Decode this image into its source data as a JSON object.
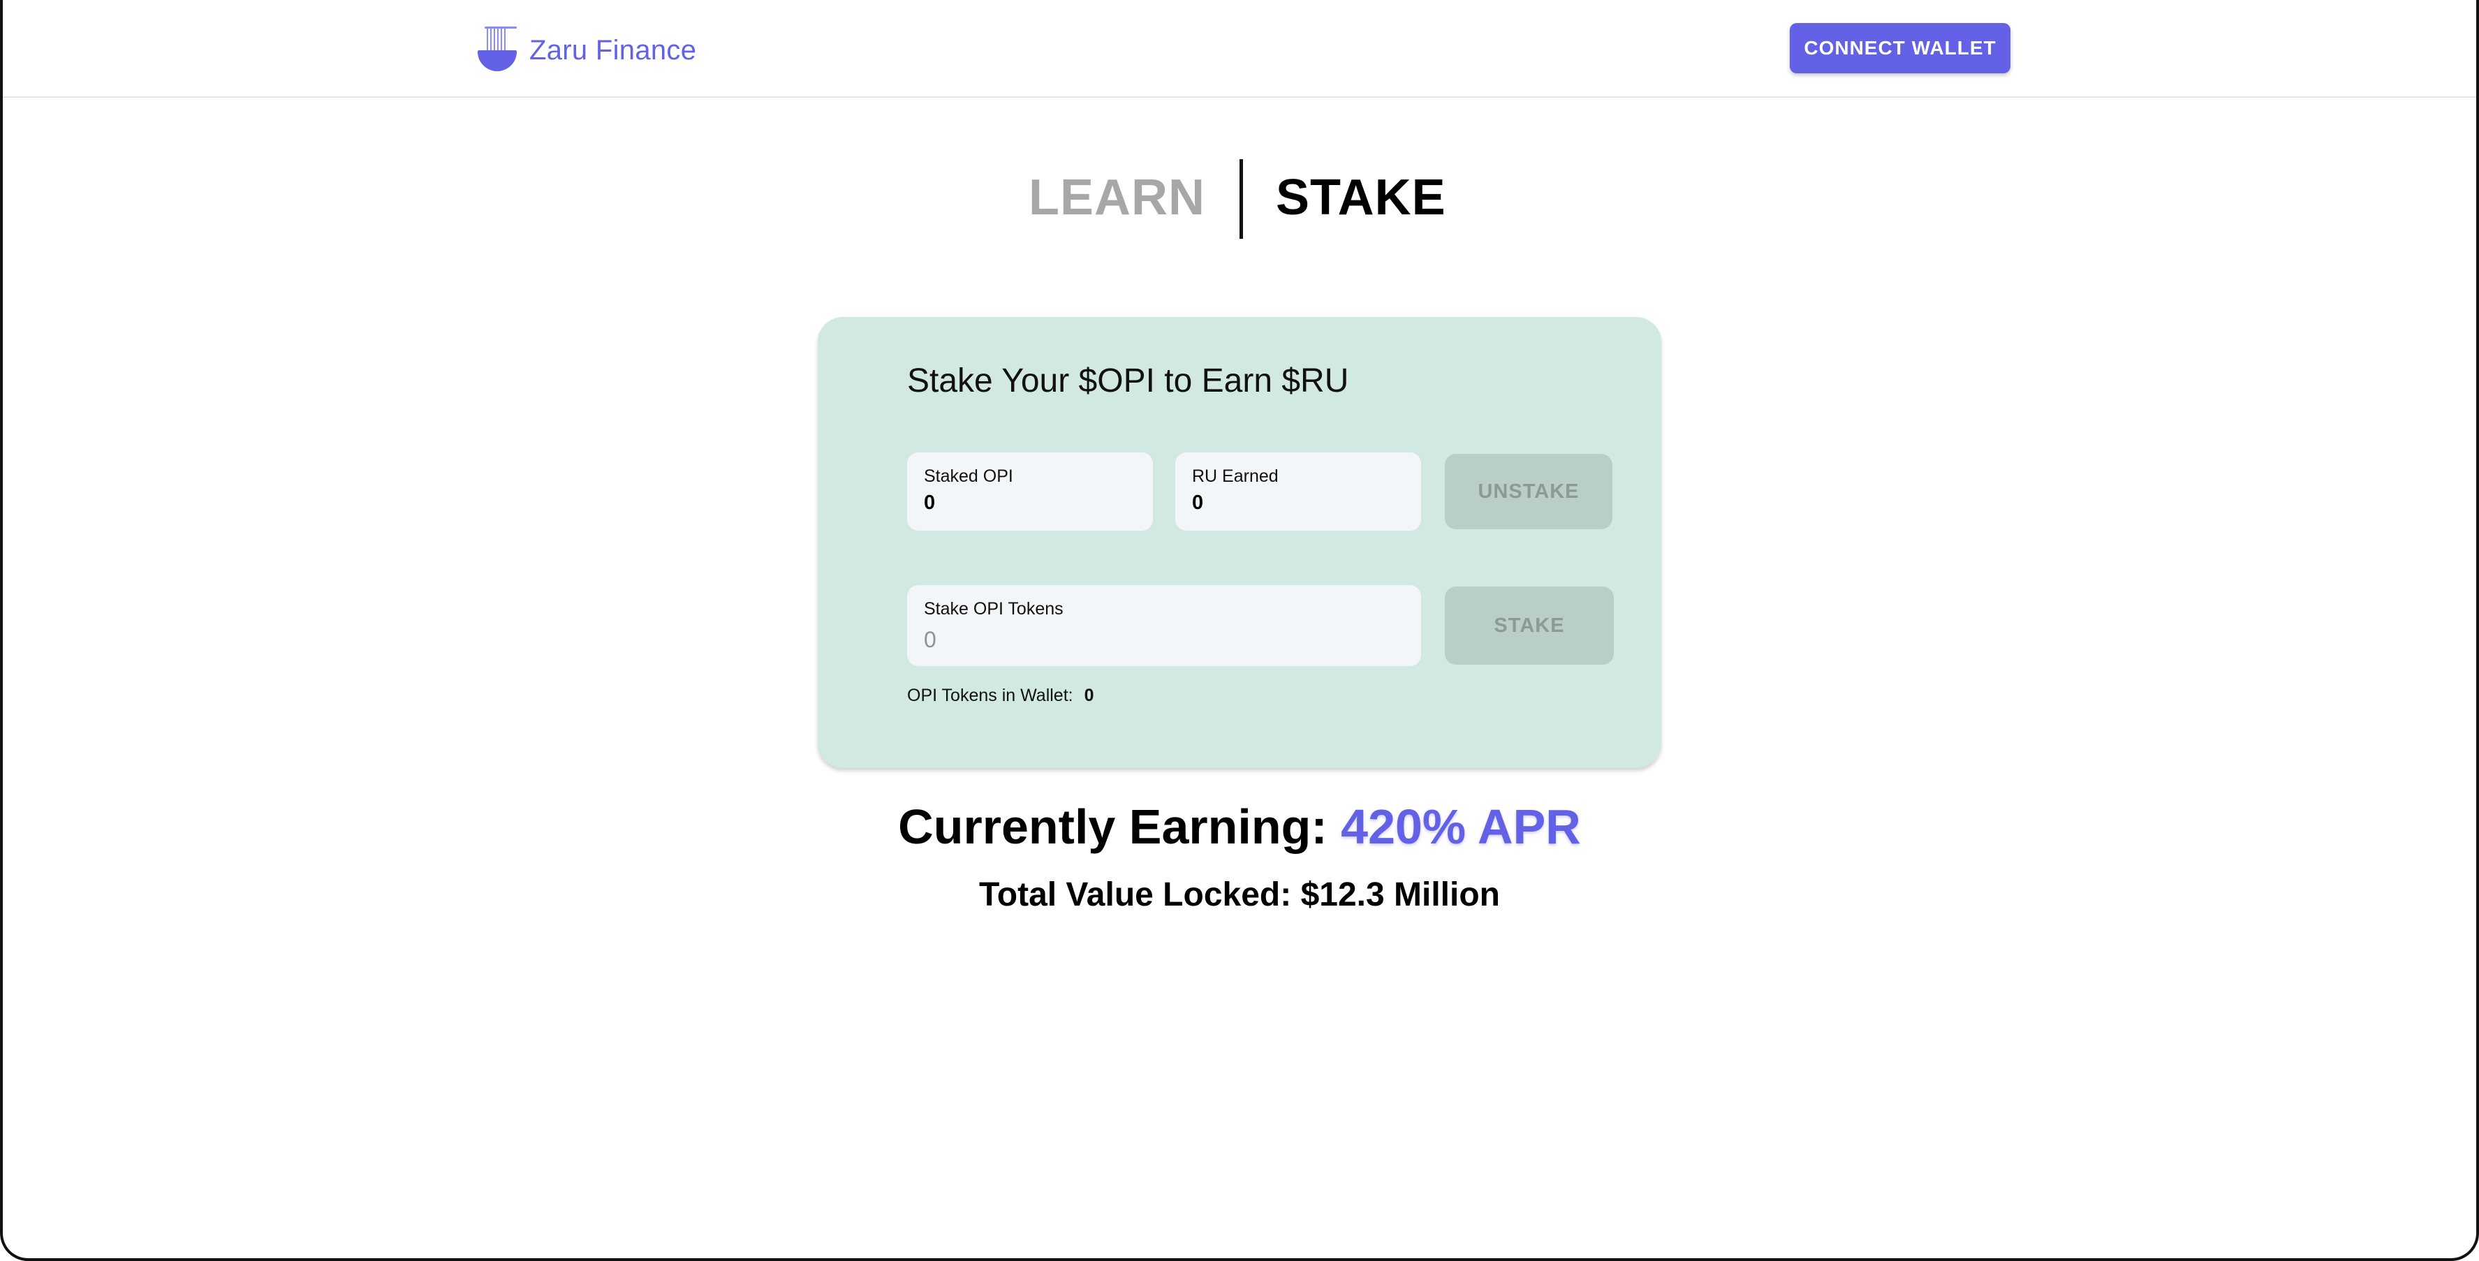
{
  "header": {
    "brand_name": "Zaru Finance",
    "logo_icon": "noodle-bowl-icon",
    "connect_label": "CONNECT WALLET"
  },
  "tabs": [
    {
      "label": "LEARN",
      "active": false
    },
    {
      "label": "STAKE",
      "active": true
    }
  ],
  "card": {
    "title": "Stake Your $OPI to Earn $RU",
    "staked": {
      "label": "Staked OPI",
      "value": "0"
    },
    "earned": {
      "label": "RU Earned",
      "value": "0"
    },
    "unstake_label": "UNSTAKE",
    "stake_input": {
      "label": "Stake OPI Tokens",
      "placeholder": "0"
    },
    "stake_label": "STAKE",
    "wallet": {
      "label": "OPI Tokens in Wallet:",
      "value": "0"
    }
  },
  "stats": {
    "earning_label": "Currently Earning:",
    "apr": "420% APR",
    "tvl_label": "Total Value Locked:",
    "tvl_value": "$12.3 Million"
  },
  "colors": {
    "accent": "#6361e6",
    "card_bg": "#d1e9e2",
    "field_bg": "#f3f6f9",
    "disabled_button": "#b8cec6",
    "inactive_tab": "#a7a7a7"
  }
}
